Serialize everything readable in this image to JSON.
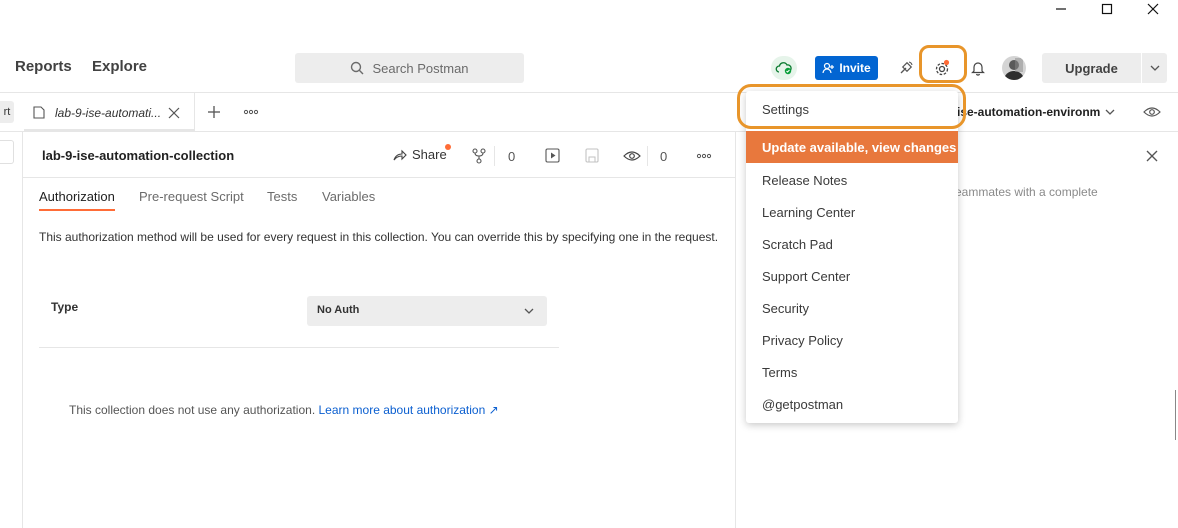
{
  "window": {
    "minimize_icon": "minimize-icon",
    "maximize_icon": "maximize-icon",
    "close_icon": "close-icon"
  },
  "header": {
    "nav": [
      "Reports",
      "Explore"
    ],
    "search": {
      "placeholder": "Search Postman",
      "icon": "search-icon"
    },
    "invite_label": "Invite",
    "upgrade_label": "Upgrade",
    "icons": [
      "cloud-sync-icon",
      "satellite-icon",
      "gear-icon",
      "bell-icon",
      "avatar"
    ]
  },
  "tabs": {
    "left_partial_label": "rt",
    "active_tab_label": "lab-9-ise-automati...",
    "environment_label": "ise-automation-environm"
  },
  "collection": {
    "title": "lab-9-ise-automation-collection",
    "share_label": "Share",
    "fork_count": "0",
    "watch_count": "0"
  },
  "subtabs": {
    "items": [
      "Authorization",
      "Pre-request Script",
      "Tests",
      "Variables"
    ],
    "active": "Authorization"
  },
  "auth": {
    "description": "This authorization method will be used for every request in this collection. You can override this by specifying one in the request.",
    "type_label": "Type",
    "type_value": "No Auth",
    "footer_text": "This collection does not use any authorization.",
    "footer_link": "Learn more about authorization ↗"
  },
  "side_panel": {
    "partial_text": "eammates with a complete"
  },
  "settings_menu": {
    "items": [
      "Settings",
      "Update available, view changes",
      "Release Notes",
      "Learning Center",
      "Scratch Pad",
      "Support Center",
      "Security",
      "Privacy Policy",
      "Terms",
      "@getpostman"
    ]
  },
  "colors": {
    "accent_orange": "#ff6c37",
    "highlight_ring": "#e8952a",
    "update_bg": "#e8783d",
    "invite_blue": "#0265d2",
    "link_blue": "#0b5fd0"
  }
}
